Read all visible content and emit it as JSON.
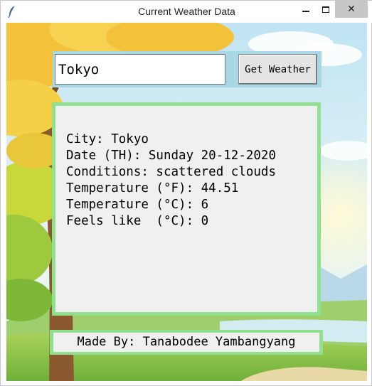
{
  "window": {
    "title": "Current Weather Data",
    "close_symbol": "✕"
  },
  "search": {
    "city_value": "Tokyo",
    "button_label": "Get Weather"
  },
  "result": {
    "lines": [
      "City: Tokyo",
      "Date (TH): Sunday 20-12-2020",
      "Conditions: scattered clouds",
      "Temperature (°F): 44.51",
      "Temperature (°C): 6",
      "Feels like  (°C): 0"
    ]
  },
  "footer": {
    "credit": "Made By: Tanabodee Yambangyang"
  },
  "colors": {
    "search_frame": "#a8d8e6",
    "panel_border": "#90e090",
    "panel_bg": "#f0f0f0"
  }
}
